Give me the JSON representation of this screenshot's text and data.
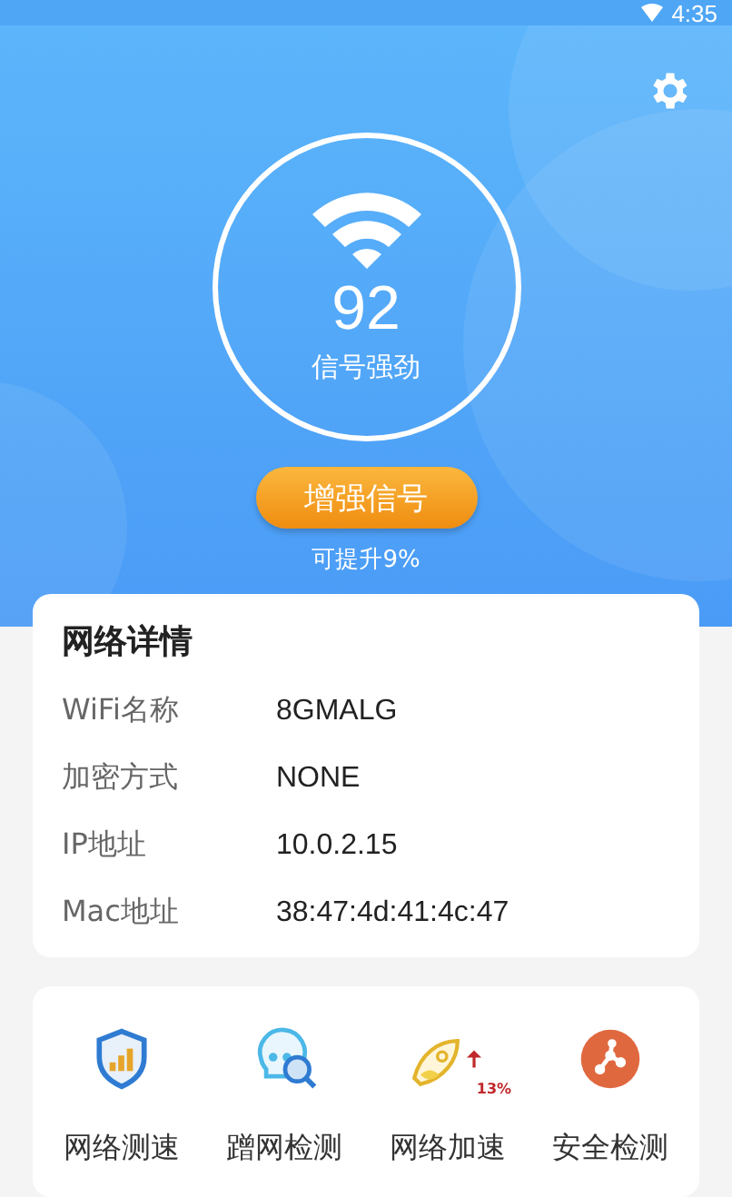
{
  "status_bar": {
    "time": "4:35"
  },
  "signal": {
    "score": "92",
    "label": "信号强劲"
  },
  "boost_button": "增强信号",
  "boost_hint": "可提升9%",
  "details": {
    "title": "网络详情",
    "rows": [
      {
        "label": "WiFi名称",
        "value": "8GMALG"
      },
      {
        "label": "加密方式",
        "value": "NONE"
      },
      {
        "label": "IP地址",
        "value": "10.0.2.15"
      },
      {
        "label": "Mac地址",
        "value": "38:47:4d:41:4c:47"
      }
    ]
  },
  "tools": [
    {
      "kind": "speed",
      "label": "网络测速"
    },
    {
      "kind": "intruder",
      "label": "蹭网检测"
    },
    {
      "kind": "boost",
      "label": "网络加速",
      "badge": "13%"
    },
    {
      "kind": "security",
      "label": "安全检测"
    }
  ]
}
